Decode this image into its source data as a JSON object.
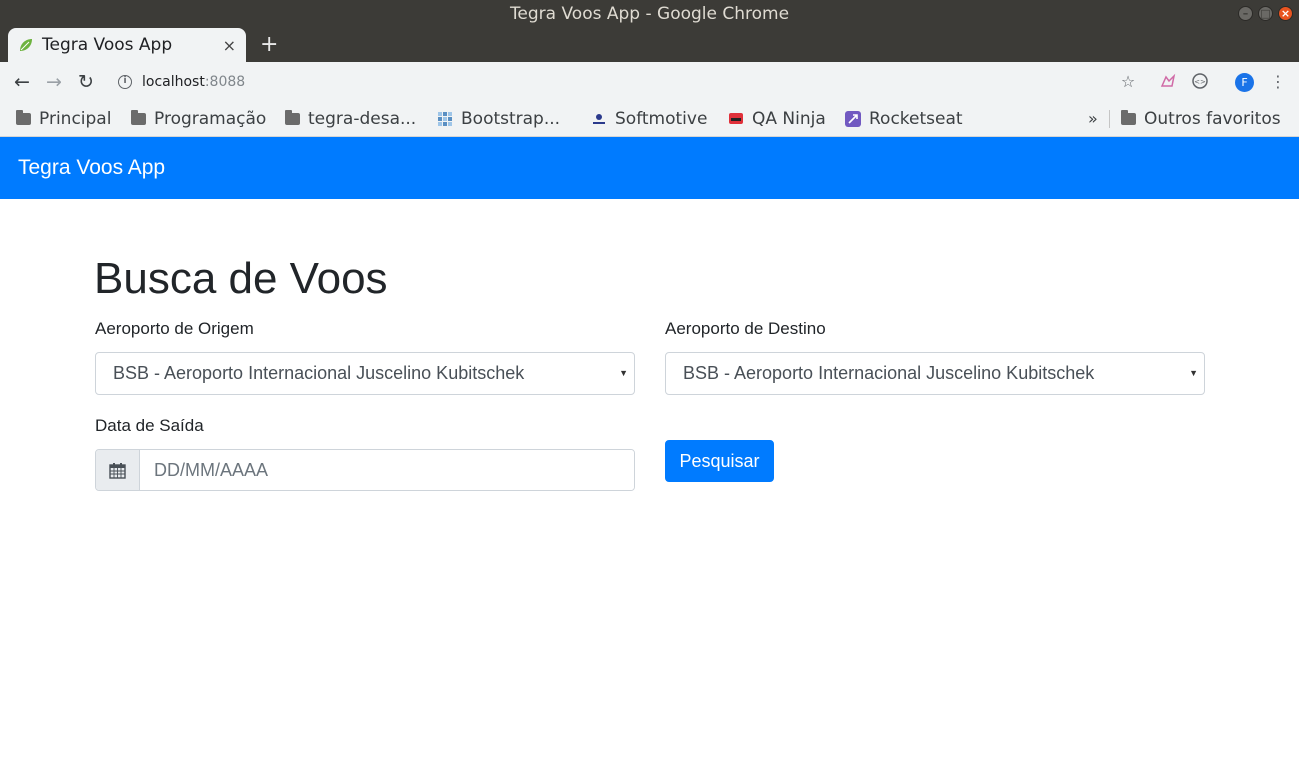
{
  "window": {
    "title": "Tegra Voos App - Google Chrome"
  },
  "tab": {
    "title": "Tegra Voos App",
    "close": "×",
    "new_tab": "+"
  },
  "toolbar": {
    "url_host": "localhost",
    "url_port": ":8088",
    "profile_initial": "F"
  },
  "bookmarks": {
    "items": [
      {
        "label": "Principal",
        "icon": "folder-icon"
      },
      {
        "label": "Programação",
        "icon": "folder-icon"
      },
      {
        "label": "tegra-desa...",
        "icon": "folder-icon"
      },
      {
        "label": "Bootstrap...",
        "icon": "bootstrap-favicon"
      },
      {
        "label": "Softmotive",
        "icon": "softmotive-favicon"
      },
      {
        "label": "QA Ninja",
        "icon": "qa-ninja-favicon"
      },
      {
        "label": "Rocketseat",
        "icon": "rocketseat-favicon"
      }
    ],
    "overflow": "»",
    "other": "Outros favoritos"
  },
  "app": {
    "brand": "Tegra Voos App",
    "heading": "Busca de Voos",
    "origin": {
      "label": "Aeroporto de Origem",
      "selected": "BSB - Aeroporto Internacional Juscelino Kubitschek"
    },
    "destination": {
      "label": "Aeroporto de Destino",
      "selected": "BSB - Aeroporto Internacional Juscelino Kubitschek"
    },
    "date": {
      "label": "Data de Saída",
      "placeholder": "DD/MM/AAAA"
    },
    "search_button": "Pesquisar"
  },
  "colors": {
    "primary": "#007bff",
    "titlebar": "#3c3b37",
    "close_button": "#e95420"
  }
}
